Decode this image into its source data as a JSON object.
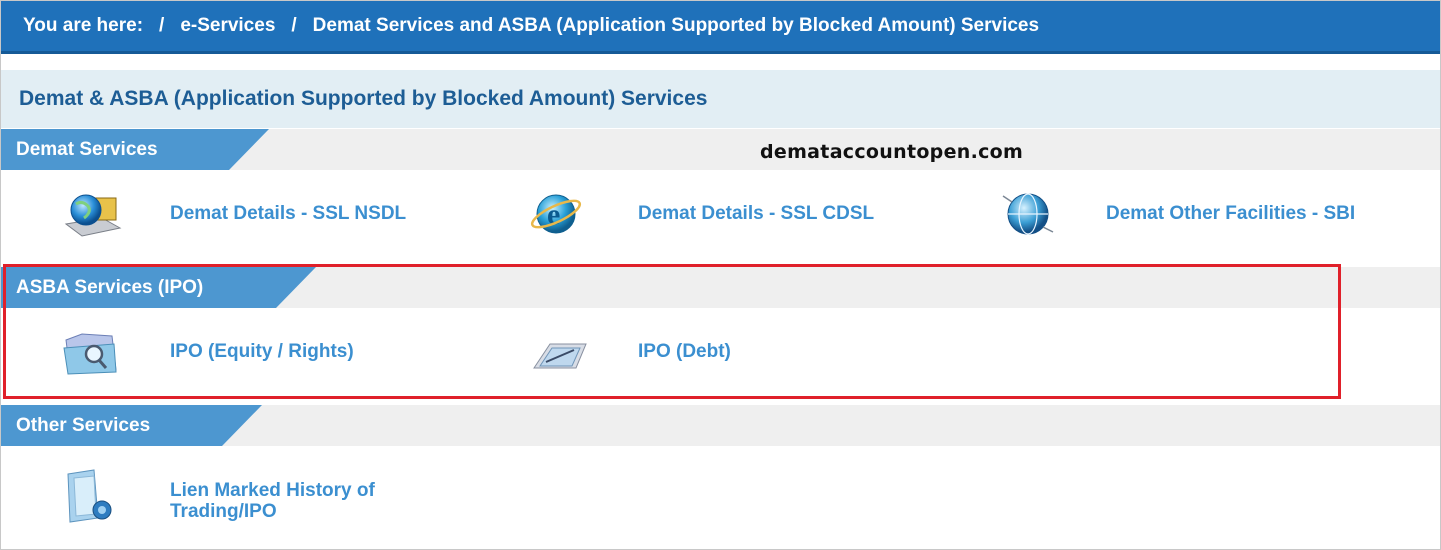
{
  "breadcrumb": {
    "prefix": "You are here:",
    "separator": "/",
    "items": [
      "e-Services",
      "Demat Services and ASBA (Application Supported by Blocked Amount) Services"
    ]
  },
  "page_title": "Demat & ASBA (Application Supported by Blocked Amount) Services",
  "watermark": "demataccountopen.com",
  "sections": [
    {
      "title": "Demat Services",
      "items": [
        {
          "label": "Demat Details - SSL NSDL",
          "icon": "globe-computer-icon"
        },
        {
          "label": "Demat Details - SSL CDSL",
          "icon": "internet-explorer-icon"
        },
        {
          "label": "Demat Other Facilities - SBI",
          "icon": "globe-network-icon"
        }
      ]
    },
    {
      "title": "ASBA Services (IPO)",
      "items": [
        {
          "label": "IPO (Equity / Rights)",
          "icon": "folder-search-icon"
        },
        {
          "label": "IPO (Debt)",
          "icon": "document-pen-icon"
        }
      ]
    },
    {
      "title": "Other Services",
      "items": [
        {
          "label": "Lien Marked History of Trading/IPO",
          "icon": "document-history-icon"
        }
      ]
    }
  ],
  "colors": {
    "breadcrumb_bg": "#1f71ba",
    "title_bg": "#e2eef4",
    "section_tab": "#4d97d0",
    "link": "#3b8fd0",
    "highlight_border": "#e0202a"
  }
}
